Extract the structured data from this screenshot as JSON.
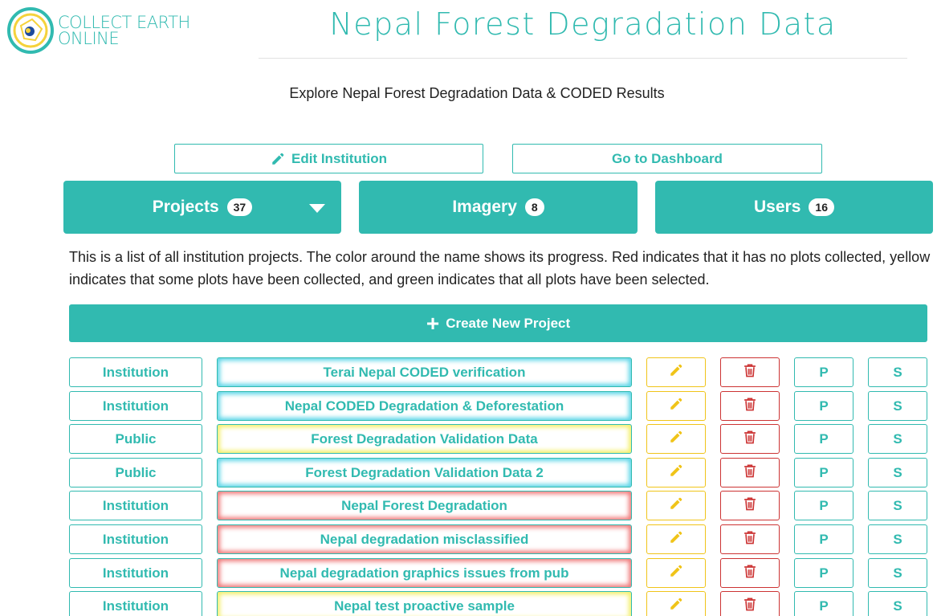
{
  "logo": {
    "line1": "COLLECT EARTH",
    "line2": "ONLINE"
  },
  "header": {
    "title": "Nepal Forest Degradation Data",
    "description": "Explore Nepal Forest Degradation Data & CODED Results"
  },
  "actions": {
    "edit_label": "Edit Institution",
    "dashboard_label": "Go to Dashboard"
  },
  "tabs": [
    {
      "label": "Projects",
      "count": "37"
    },
    {
      "label": "Imagery",
      "count": "8"
    },
    {
      "label": "Users",
      "count": "16"
    }
  ],
  "info_text": "This is a list of all institution projects. The color around the name shows its progress. Red indicates that it has no plots collected, yellow indicates that some plots have been collected, and green indicates that all plots have been selected.",
  "create_label": "Create New Project",
  "colors": {
    "accent": "#31bab0",
    "edit": "#f0c419",
    "delete": "#cc3333",
    "progress_blue": "#5ed6e8",
    "progress_yellow": "#f4f06a",
    "progress_red": "#f07a7a"
  },
  "row_buttons": {
    "p_label": "P",
    "s_label": "S",
    "edit_icon": "pencil-icon",
    "delete_icon": "trash-icon"
  },
  "projects": [
    {
      "visibility": "Institution",
      "name": "Terai Nepal CODED verification",
      "progress": "blue"
    },
    {
      "visibility": "Institution",
      "name": "Nepal CODED Degradation & Deforestation",
      "progress": "blue"
    },
    {
      "visibility": "Public",
      "name": "Forest Degradation Validation Data",
      "progress": "yellow"
    },
    {
      "visibility": "Public",
      "name": "Forest Degradation Validation Data 2",
      "progress": "blue"
    },
    {
      "visibility": "Institution",
      "name": "Nepal Forest Degradation",
      "progress": "red"
    },
    {
      "visibility": "Institution",
      "name": "Nepal degradation misclassified",
      "progress": "red"
    },
    {
      "visibility": "Institution",
      "name": "Nepal degradation graphics issues from pub",
      "progress": "red"
    },
    {
      "visibility": "Institution",
      "name": "Nepal test proactive sample",
      "progress": "yellow"
    }
  ]
}
